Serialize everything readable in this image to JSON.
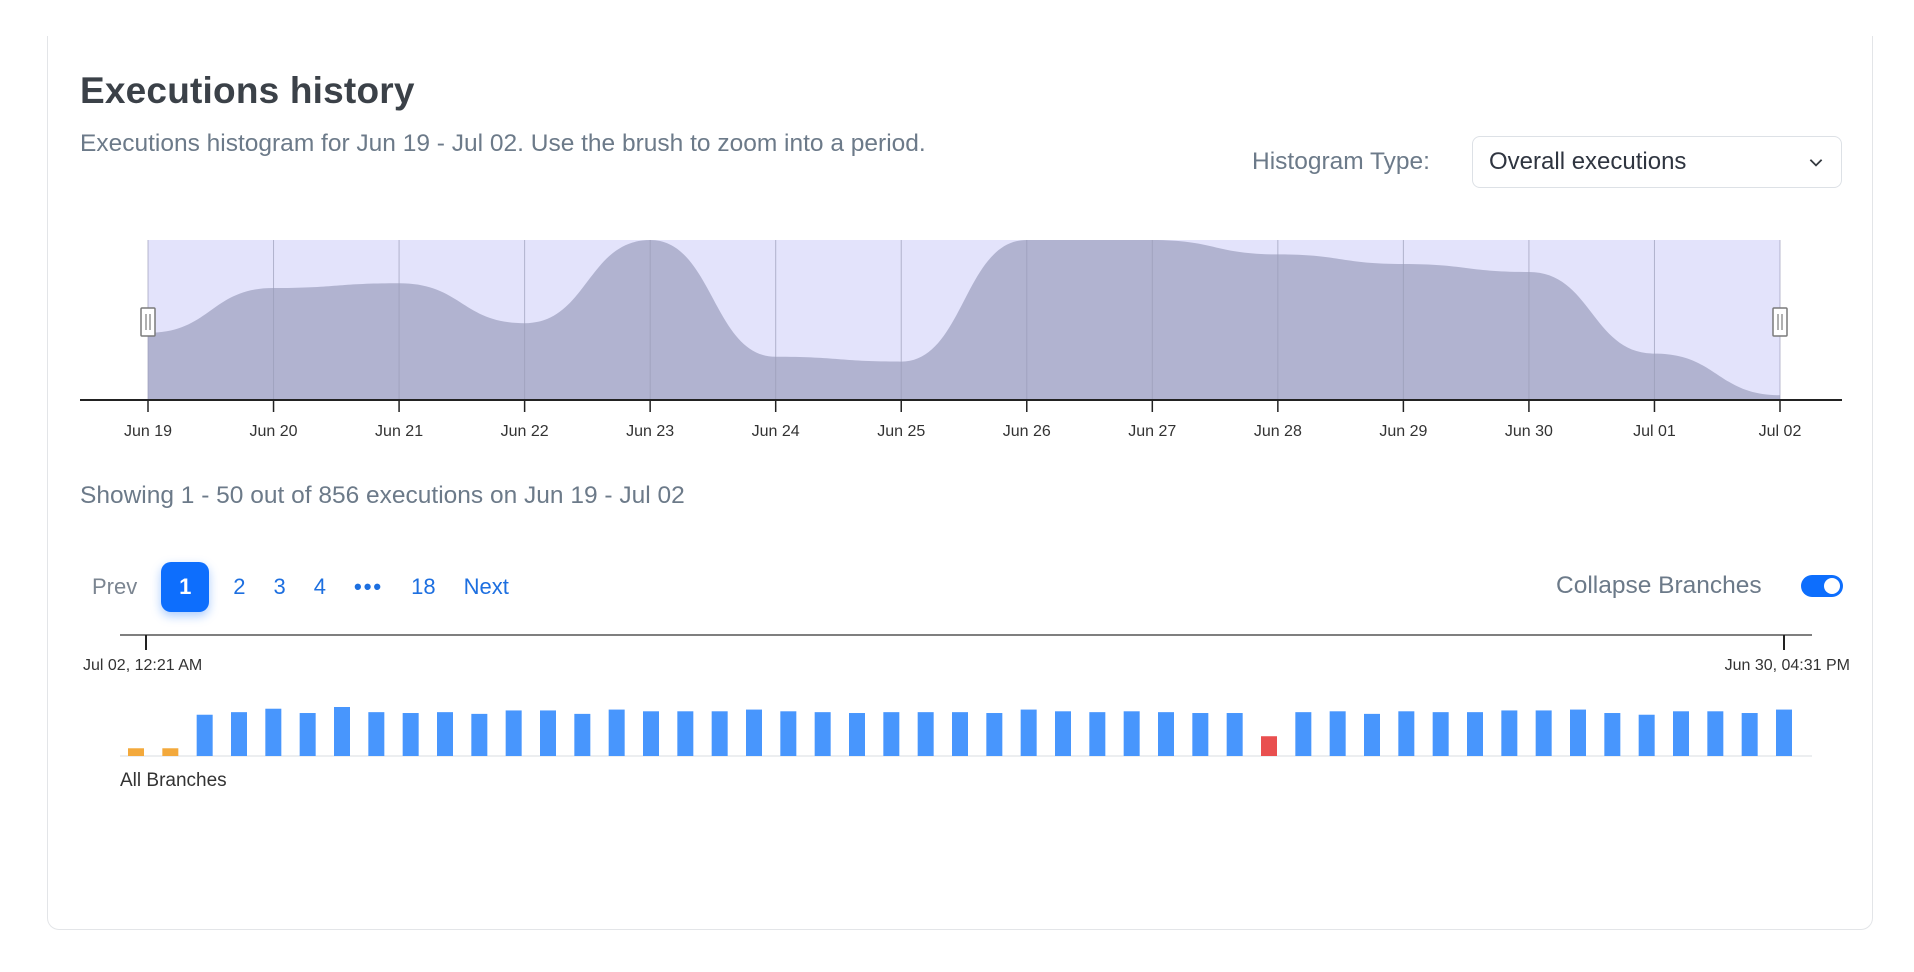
{
  "header": {
    "title": "Executions history",
    "description": "Executions histogram for Jun 19 - Jul 02. Use the brush to zoom into a period."
  },
  "histogram_type": {
    "label": "Histogram Type:",
    "selected": "Overall executions",
    "icon": "chevron-down-icon"
  },
  "chart_data": [
    {
      "type": "area",
      "x": [
        "Jun 19",
        "Jun 20",
        "Jun 21",
        "Jun 22",
        "Jun 23",
        "Jun 24",
        "Jun 25",
        "Jun 26",
        "Jun 27",
        "Jun 28",
        "Jun 29",
        "Jun 30",
        "Jul 01",
        "Jul 02"
      ],
      "values": [
        42,
        70,
        73,
        48,
        100,
        27,
        24,
        100,
        100,
        91,
        85,
        80,
        29,
        3
      ],
      "ylim": [
        0,
        100
      ],
      "brush": [
        "Jun 19",
        "Jul 02"
      ],
      "colors": {
        "area": "#b1b3d0",
        "brush": "#e3e3fb",
        "grid": "#9a9cb8"
      }
    },
    {
      "type": "bar",
      "x_range_labels": [
        "Jul 02, 12:21 AM",
        "Jun 30, 04:31 PM"
      ],
      "values": [
        9,
        9,
        48,
        51,
        55,
        50,
        57,
        51,
        50,
        51,
        49,
        53,
        53,
        49,
        54,
        52,
        52,
        52,
        54,
        52,
        51,
        50,
        51,
        51,
        51,
        50,
        54,
        52,
        51,
        52,
        51,
        50,
        50,
        23,
        51,
        52,
        49,
        52,
        51,
        51,
        53,
        53,
        54,
        50,
        48,
        52,
        52,
        50,
        54
      ],
      "statuses": [
        "warning",
        "warning",
        "success",
        "success",
        "success",
        "success",
        "success",
        "success",
        "success",
        "success",
        "success",
        "success",
        "success",
        "success",
        "success",
        "success",
        "success",
        "success",
        "success",
        "success",
        "success",
        "success",
        "success",
        "success",
        "success",
        "success",
        "success",
        "success",
        "success",
        "success",
        "success",
        "success",
        "success",
        "failed",
        "success",
        "success",
        "success",
        "success",
        "success",
        "success",
        "success",
        "success",
        "success",
        "success",
        "success",
        "success",
        "success",
        "success",
        "success"
      ],
      "colors": {
        "success": "#4896fd",
        "warning": "#f3a93c",
        "failed": "#e94f4f"
      }
    }
  ],
  "summary": {
    "showing": "Showing 1 - 50 out of 856 executions on Jun 19 - Jul 02"
  },
  "pagination": {
    "prev": "Prev",
    "pages": [
      "1",
      "2",
      "3",
      "4"
    ],
    "ellipsis": "•••",
    "last": "18",
    "next": "Next"
  },
  "collapse": {
    "label": "Collapse Branches",
    "on": true
  },
  "branch_label": "All Branches"
}
